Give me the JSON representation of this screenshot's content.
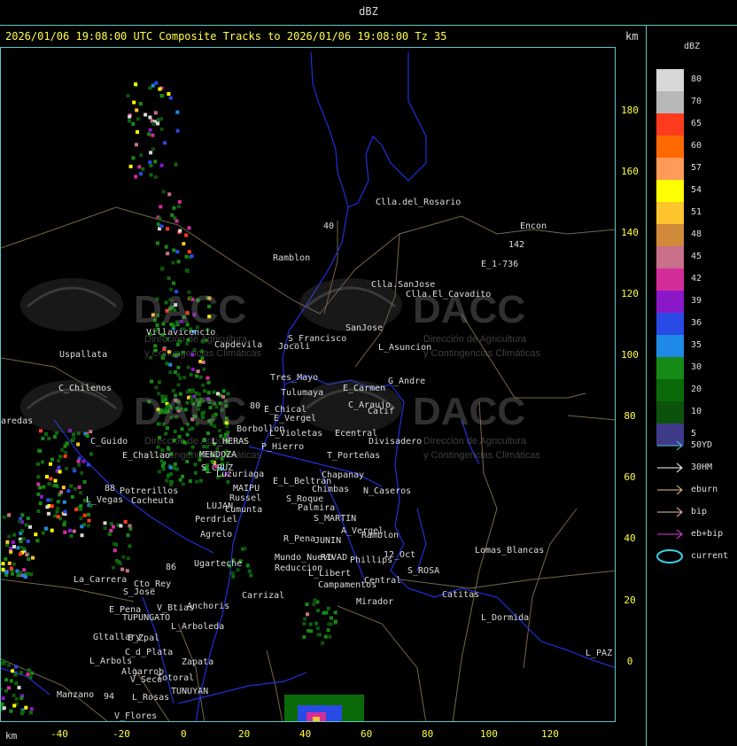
{
  "header": {
    "unit_title": "dBZ"
  },
  "headline": "2026/01/06 19:08:00 UTC Composite Tracks to 2026/01/06 19:08:00 Tz 35",
  "axis": {
    "km_label": "km",
    "y_ticks": [
      "180",
      "160",
      "140",
      "120",
      "100",
      "80",
      "60",
      "40",
      "20",
      "0"
    ],
    "x_ticks": [
      "-40",
      "-20",
      "0",
      "20",
      "40",
      "60",
      "80",
      "100",
      "120"
    ]
  },
  "legend": {
    "title": "dBZ",
    "scale": [
      {
        "label": "80",
        "color": "#d8d8d8"
      },
      {
        "label": "70",
        "color": "#b8b8b8"
      },
      {
        "label": "65",
        "color": "#ff3b1e"
      },
      {
        "label": "60",
        "color": "#ff6a00"
      },
      {
        "label": "57",
        "color": "#ff9a5a"
      },
      {
        "label": "54",
        "color": "#ffff00"
      },
      {
        "label": "51",
        "color": "#ffc42e"
      },
      {
        "label": "48",
        "color": "#d08a3a"
      },
      {
        "label": "45",
        "color": "#c8708a"
      },
      {
        "label": "42",
        "color": "#d42d9a"
      },
      {
        "label": "39",
        "color": "#8a18c8"
      },
      {
        "label": "36",
        "color": "#2a4ae6"
      },
      {
        "label": "35",
        "color": "#1e8ae6"
      },
      {
        "label": "30",
        "color": "#168a16"
      },
      {
        "label": "20",
        "color": "#0a6a0a"
      },
      {
        "label": "10",
        "color": "#0c520c"
      },
      {
        "label": "5",
        "color": "#403a8a"
      }
    ],
    "tracks": [
      {
        "label": "50YD",
        "color": "#4ac8d8"
      },
      {
        "label": "30HM",
        "color": "#ffffff"
      },
      {
        "label": "eburn",
        "color": "#e8c48a"
      },
      {
        "label": "bip",
        "color": "#f0c0b0"
      },
      {
        "label": "eb+bip",
        "color": "#e040e0"
      },
      {
        "label": "current",
        "color": "#3ad0e8"
      }
    ]
  },
  "watermark": {
    "brand": "DACC",
    "line1": "Dirección de Agricultura",
    "line2": "y Contingencias Climáticas"
  },
  "places": [
    {
      "name": "Clla.del_Rosario"
    },
    {
      "name": "Encon"
    },
    {
      "name": "142"
    },
    {
      "name": "E_1-736"
    },
    {
      "name": "Ramblon"
    },
    {
      "name": "Clla.SanJose"
    },
    {
      "name": "Clla.El_Cavadito"
    },
    {
      "name": "Villavicencio"
    },
    {
      "name": "Capdevila"
    },
    {
      "name": "S_Francisco"
    },
    {
      "name": "SanJose"
    },
    {
      "name": "L_Asuncion"
    },
    {
      "name": "Jocoli"
    },
    {
      "name": "Uspallata"
    },
    {
      "name": "Tres_Mayo"
    },
    {
      "name": "G_Andre"
    },
    {
      "name": "E_Carmen"
    },
    {
      "name": "C_Chilenos"
    },
    {
      "name": "Tulumaya"
    },
    {
      "name": "C_Araujo"
    },
    {
      "name": "E_Chical"
    },
    {
      "name": "E_Vergel"
    },
    {
      "name": "Calif"
    },
    {
      "name": "aredas"
    },
    {
      "name": "Borbollon"
    },
    {
      "name": "L_Violetas"
    },
    {
      "name": "Ecentral"
    },
    {
      "name": "Divisadero"
    },
    {
      "name": "C_Guido"
    },
    {
      "name": "L_HERAS"
    },
    {
      "name": "P_Hierro"
    },
    {
      "name": "E_Challao"
    },
    {
      "name": "MENDOZA"
    },
    {
      "name": "T_Porteñas"
    },
    {
      "name": "S_CRUZ"
    },
    {
      "name": "Luzuriaga"
    },
    {
      "name": "E_L_Beltran"
    },
    {
      "name": "Chapanay"
    },
    {
      "name": "Potrerillos"
    },
    {
      "name": "MAIPU"
    },
    {
      "name": "Chimbas"
    },
    {
      "name": "N_Caseros"
    },
    {
      "name": "L_Vegas"
    },
    {
      "name": "Cacheuta"
    },
    {
      "name": "Russel"
    },
    {
      "name": "S_Roque"
    },
    {
      "name": "LUJAN"
    },
    {
      "name": "Cumunta"
    },
    {
      "name": "Palmira"
    },
    {
      "name": "Perdriel"
    },
    {
      "name": "S_MARTIN"
    },
    {
      "name": "A_Vergel"
    },
    {
      "name": "Agrelo"
    },
    {
      "name": "R_Pena"
    },
    {
      "name": "JUNIN"
    },
    {
      "name": "Ramblon"
    },
    {
      "name": "Lomas_Blancas"
    },
    {
      "name": "12_Oct"
    },
    {
      "name": "Mundo_Nuevo"
    },
    {
      "name": "RIVAD"
    },
    {
      "name": "Phillips"
    },
    {
      "name": "Ugarteche"
    },
    {
      "name": "Reduccion"
    },
    {
      "name": "L_Libert"
    },
    {
      "name": "S_ROSA"
    },
    {
      "name": "La_Carrera"
    },
    {
      "name": "Cto_Rey"
    },
    {
      "name": "Central"
    },
    {
      "name": "S_Jose"
    },
    {
      "name": "Campamentos"
    },
    {
      "name": "Catitas"
    },
    {
      "name": "Carrizal"
    },
    {
      "name": "Anchoris"
    },
    {
      "name": "Mirador"
    },
    {
      "name": "E_Pena"
    },
    {
      "name": "V_Btias"
    },
    {
      "name": "TUPUNGATO"
    },
    {
      "name": "L_Dormida"
    },
    {
      "name": "L_Arboleda"
    },
    {
      "name": "E_Zpal"
    },
    {
      "name": "Gltallary"
    },
    {
      "name": "C_d_Plata"
    },
    {
      "name": "L_Arbols"
    },
    {
      "name": "Zapata"
    },
    {
      "name": "L_PAZ"
    },
    {
      "name": "V_Seco"
    },
    {
      "name": "Algarrob"
    },
    {
      "name": "Totoral"
    },
    {
      "name": "Manzano"
    },
    {
      "name": "TUNUYAN"
    },
    {
      "name": "94"
    },
    {
      "name": "L_Rosas"
    },
    {
      "name": "V_Flores"
    },
    {
      "name": "40"
    },
    {
      "name": "88"
    },
    {
      "name": "86"
    },
    {
      "name": "80"
    }
  ]
}
